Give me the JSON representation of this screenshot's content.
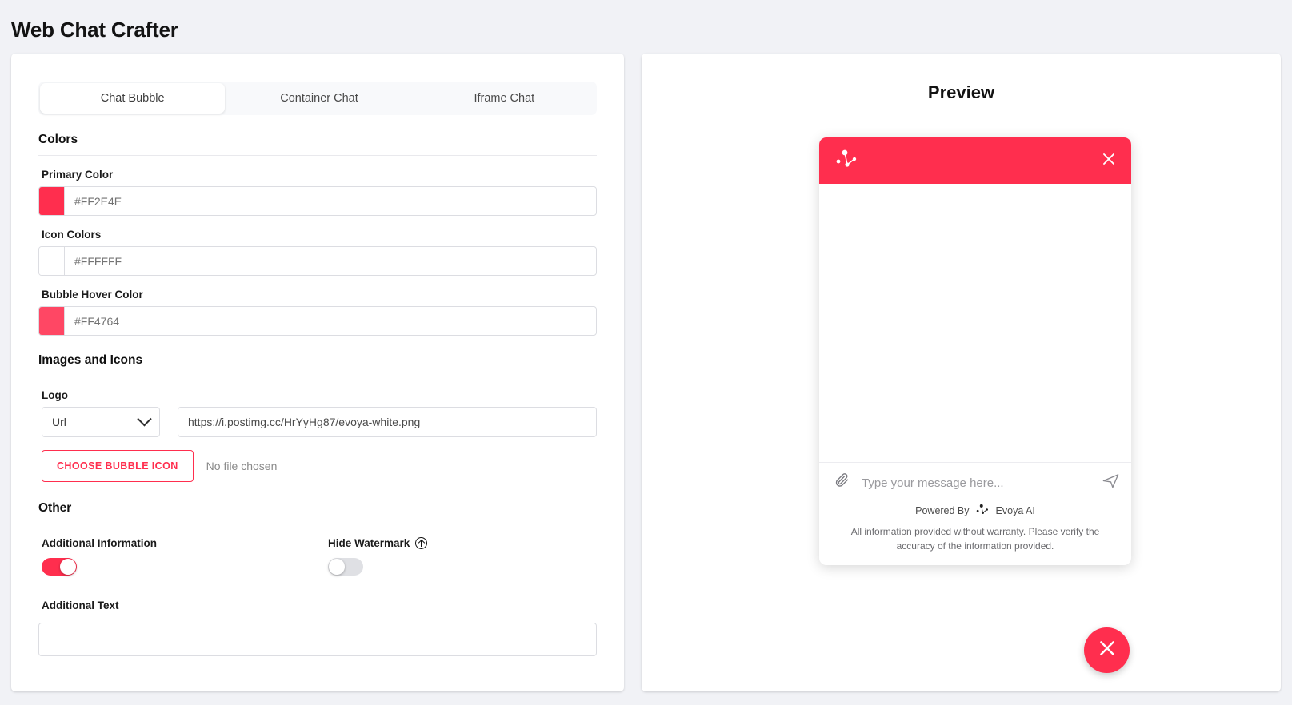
{
  "app": {
    "title": "Web Chat Crafter"
  },
  "tabs": [
    {
      "label": "Chat Bubble",
      "active": true
    },
    {
      "label": "Container Chat",
      "active": false
    },
    {
      "label": "Iframe Chat",
      "active": false
    }
  ],
  "sections": {
    "colors": {
      "heading": "Colors",
      "fields": [
        {
          "label": "Primary Color",
          "value": "#FF2E4E",
          "swatch": "#FF2E4E"
        },
        {
          "label": "Icon Colors",
          "value": "#FFFFFF",
          "swatch": "#FFFFFF"
        },
        {
          "label": "Bubble Hover Color",
          "value": "#FF4764",
          "swatch": "#FF4764"
        }
      ]
    },
    "images": {
      "heading": "Images and Icons",
      "logo_label": "Logo",
      "source_type": "Url",
      "logo_url": "https://i.postimg.cc/HrYyHg87/evoya-white.png",
      "choose_button": "CHOOSE BUBBLE ICON",
      "file_status": "No file chosen"
    },
    "other": {
      "heading": "Other",
      "additional_information_label": "Additional Information",
      "additional_information_on": true,
      "hide_watermark_label": "Hide Watermark",
      "hide_watermark_on": false,
      "additional_text_label": "Additional Text",
      "additional_text_value": ""
    }
  },
  "preview": {
    "title": "Preview",
    "header_color": "#FF2E4E",
    "close_icon": "close-icon",
    "logo_icon": "evoya-network-logo-icon",
    "attach_icon": "paperclip-icon",
    "send_icon": "send-icon",
    "message_placeholder": "Type your message here...",
    "powered_by": "Powered By",
    "brand": "Evoya AI",
    "disclaimer": "All information provided without warranty. Please verify the accuracy of the information provided.",
    "fab_icon": "close-icon"
  }
}
